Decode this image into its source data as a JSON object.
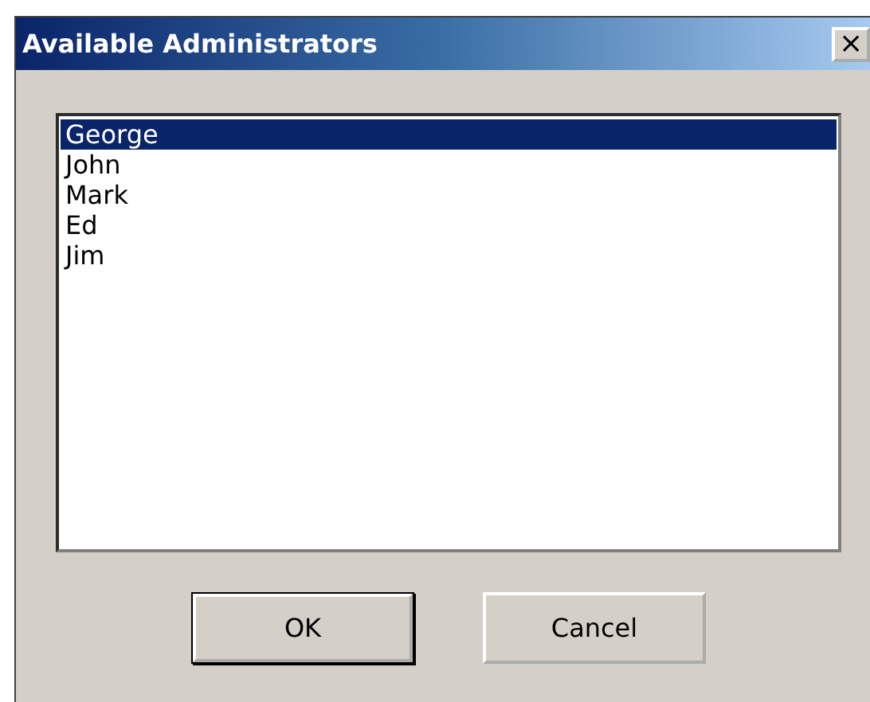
{
  "window": {
    "title": "Available Administrators",
    "close": "×"
  },
  "list": {
    "items": [
      {
        "label": "George",
        "selected": true
      },
      {
        "label": "John",
        "selected": false
      },
      {
        "label": "Mark",
        "selected": false
      },
      {
        "label": "Ed",
        "selected": false
      },
      {
        "label": "Jim",
        "selected": false
      }
    ]
  },
  "buttons": [
    {
      "label": "OK",
      "default": true
    },
    {
      "label": "Cancel",
      "default": false
    }
  ]
}
